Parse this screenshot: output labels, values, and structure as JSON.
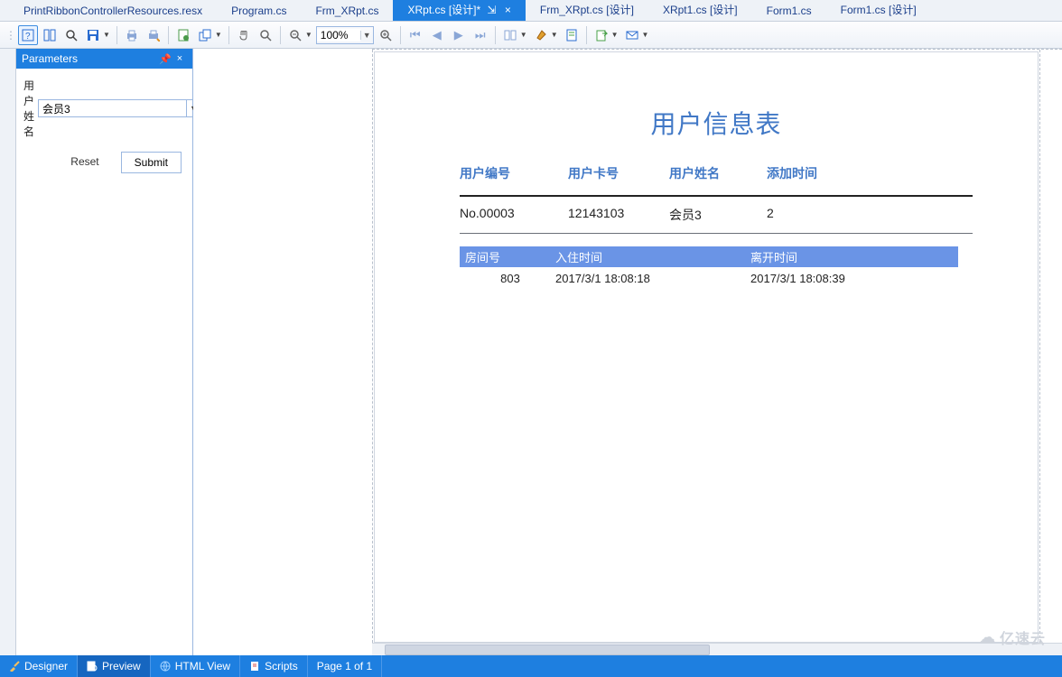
{
  "tabs": [
    {
      "label": "PrintRibbonControllerResources.resx"
    },
    {
      "label": "Program.cs"
    },
    {
      "label": "Frm_XRpt.cs"
    },
    {
      "label": "XRpt.cs [设计]*",
      "active": true
    },
    {
      "label": "Frm_XRpt.cs [设计]"
    },
    {
      "label": "XRpt1.cs [设计]"
    },
    {
      "label": "Form1.cs"
    },
    {
      "label": "Form1.cs [设计]"
    }
  ],
  "toolbar": {
    "zoom": "100%"
  },
  "parameters": {
    "title": "Parameters",
    "field_label": "用户姓名",
    "field_value": "会员3",
    "reset": "Reset",
    "submit": "Submit"
  },
  "report": {
    "title": "用户信息表",
    "headers": {
      "id": "用户编号",
      "card": "用户卡号",
      "name": "用户姓名",
      "addtime": "添加时间"
    },
    "row": {
      "id": "No.00003",
      "card": "12143103",
      "name": "会员3",
      "addtime": "2"
    },
    "sub_headers": {
      "room": "房间号",
      "checkin": "入住时间",
      "checkout": "离开时间"
    },
    "sub_row": {
      "room": "803",
      "checkin": "2017/3/1 18:08:18",
      "checkout": "2017/3/1 18:08:39"
    }
  },
  "statusbar": {
    "designer": "Designer",
    "preview": "Preview",
    "htmlview": "HTML View",
    "scripts": "Scripts",
    "pageinfo": "Page 1 of 1"
  },
  "watermark": "亿速云"
}
